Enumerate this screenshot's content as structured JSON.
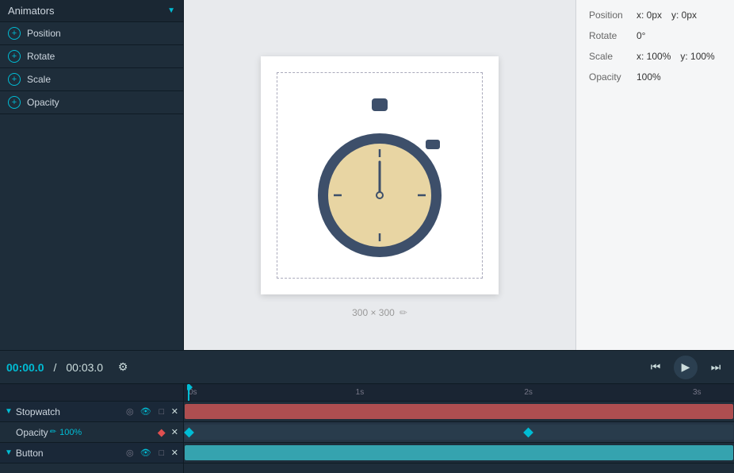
{
  "left_panel": {
    "animators_title": "Animators",
    "items": [
      {
        "label": "Position"
      },
      {
        "label": "Rotate"
      },
      {
        "label": "Scale"
      },
      {
        "label": "Opacity"
      }
    ]
  },
  "right_panel": {
    "position_label": "Position",
    "position_x": "x: 0px",
    "position_y": "y: 0px",
    "rotate_label": "Rotate",
    "rotate_value": "0°",
    "scale_label": "Scale",
    "scale_x": "x: 100%",
    "scale_y": "y: 100%",
    "opacity_label": "Opacity",
    "opacity_value": "100%"
  },
  "canvas": {
    "size_label": "300 × 300"
  },
  "timeline": {
    "current_time": "00:00.0",
    "total_time": "00:03.0",
    "rows": [
      {
        "label": "Stopwatch",
        "type": "stopwatch"
      },
      {
        "label": "Opacity",
        "value": "100%",
        "type": "opacity"
      },
      {
        "label": "Button",
        "type": "button"
      }
    ],
    "tick_labels": [
      "0s",
      "1s",
      "2s",
      "3s"
    ]
  },
  "icons": {
    "gear": "⚙",
    "rewind": "⏮",
    "play": "▶",
    "forward": "⏭",
    "target": "◎",
    "eye": "👁",
    "pencil": "✏",
    "x": "✕",
    "triangle_down": "▼",
    "arrow_down": "▾",
    "edit_canvas": "✏"
  }
}
